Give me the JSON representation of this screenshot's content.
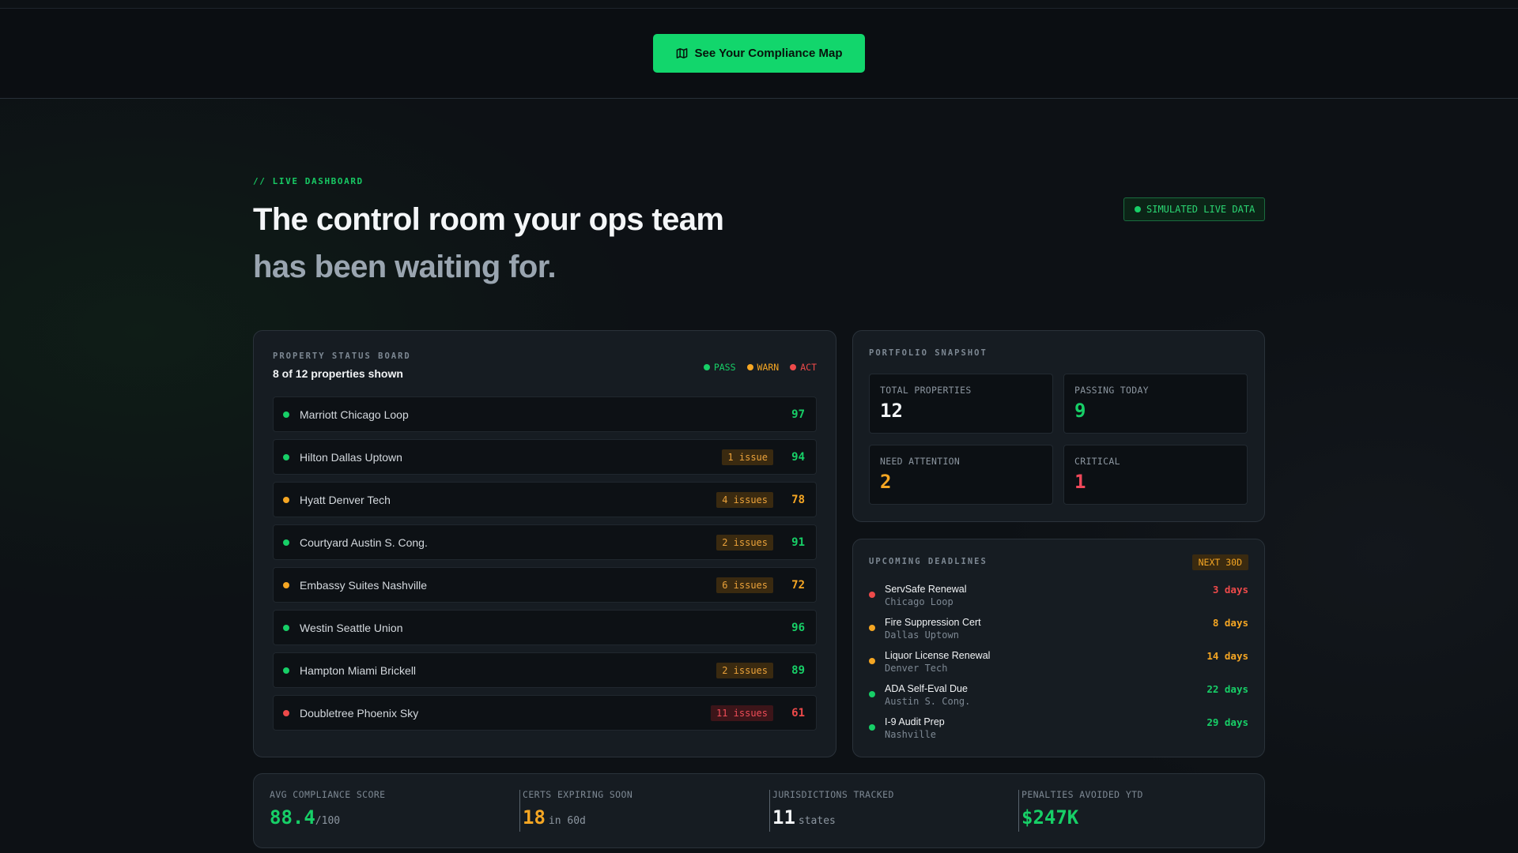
{
  "cta": {
    "label": "See Your Compliance Map",
    "icon": "map-icon"
  },
  "hero": {
    "eyebrow": "// LIVE DASHBOARD",
    "title_line1": "The control room your ops team",
    "title_line2": "has been waiting for.",
    "live_badge": "SIMULATED LIVE DATA"
  },
  "colors": {
    "pass": "#17cf67",
    "warn": "#f5a623",
    "act": "#ee4a4a",
    "cta": "#12d66c"
  },
  "board": {
    "title": "PROPERTY STATUS BOARD",
    "subtitle": "8 of 12 properties shown",
    "legend": {
      "pass": "PASS",
      "warn": "WARN",
      "act": "ACT"
    },
    "rows": [
      {
        "name": "Marriott Chicago Loop",
        "status": "pass",
        "issues": "",
        "score": "97"
      },
      {
        "name": "Hilton Dallas Uptown",
        "status": "pass",
        "issues": "1 issue",
        "score": "94"
      },
      {
        "name": "Hyatt Denver Tech",
        "status": "warn",
        "issues": "4 issues",
        "score": "78"
      },
      {
        "name": "Courtyard Austin S. Cong.",
        "status": "pass",
        "issues": "2 issues",
        "score": "91"
      },
      {
        "name": "Embassy Suites Nashville",
        "status": "warn",
        "issues": "6 issues",
        "score": "72"
      },
      {
        "name": "Westin Seattle Union",
        "status": "pass",
        "issues": "",
        "score": "96"
      },
      {
        "name": "Hampton Miami Brickell",
        "status": "pass",
        "issues": "2 issues",
        "score": "89"
      },
      {
        "name": "Doubletree Phoenix Sky",
        "status": "act",
        "issues": "11 issues",
        "score": "61"
      }
    ]
  },
  "snapshot": {
    "title": "PORTFOLIO SNAPSHOT",
    "total_label": "TOTAL PROPERTIES",
    "total_value": "12",
    "passing_label": "PASSING TODAY",
    "passing_value": "9",
    "attention_label": "NEED ATTENTION",
    "attention_value": "2",
    "critical_label": "CRITICAL",
    "critical_value": "1"
  },
  "deadlines": {
    "title": "UPCOMING DEADLINES",
    "badge": "NEXT 30D",
    "items": [
      {
        "title": "ServSafe Renewal",
        "location": "Chicago Loop",
        "days": "3 days",
        "status": "act"
      },
      {
        "title": "Fire Suppression Cert",
        "location": "Dallas Uptown",
        "days": "8 days",
        "status": "warn"
      },
      {
        "title": "Liquor License Renewal",
        "location": "Denver Tech",
        "days": "14 days",
        "status": "warn"
      },
      {
        "title": "ADA Self-Eval Due",
        "location": "Austin S. Cong.",
        "days": "22 days",
        "status": "pass"
      },
      {
        "title": "I-9 Audit Prep",
        "location": "Nashville",
        "days": "29 days",
        "status": "pass"
      }
    ]
  },
  "metrics": {
    "avg_label": "AVG COMPLIANCE SCORE",
    "avg_value": "88.4",
    "avg_suffix": "/100",
    "certs_label": "CERTS EXPIRING SOON",
    "certs_value": "18",
    "certs_suffix": "in 60d",
    "juris_label": "JURISDICTIONS TRACKED",
    "juris_value": "11",
    "juris_suffix": "states",
    "penalties_label": "PENALTIES AVOIDED YTD",
    "penalties_value": "$247K"
  }
}
